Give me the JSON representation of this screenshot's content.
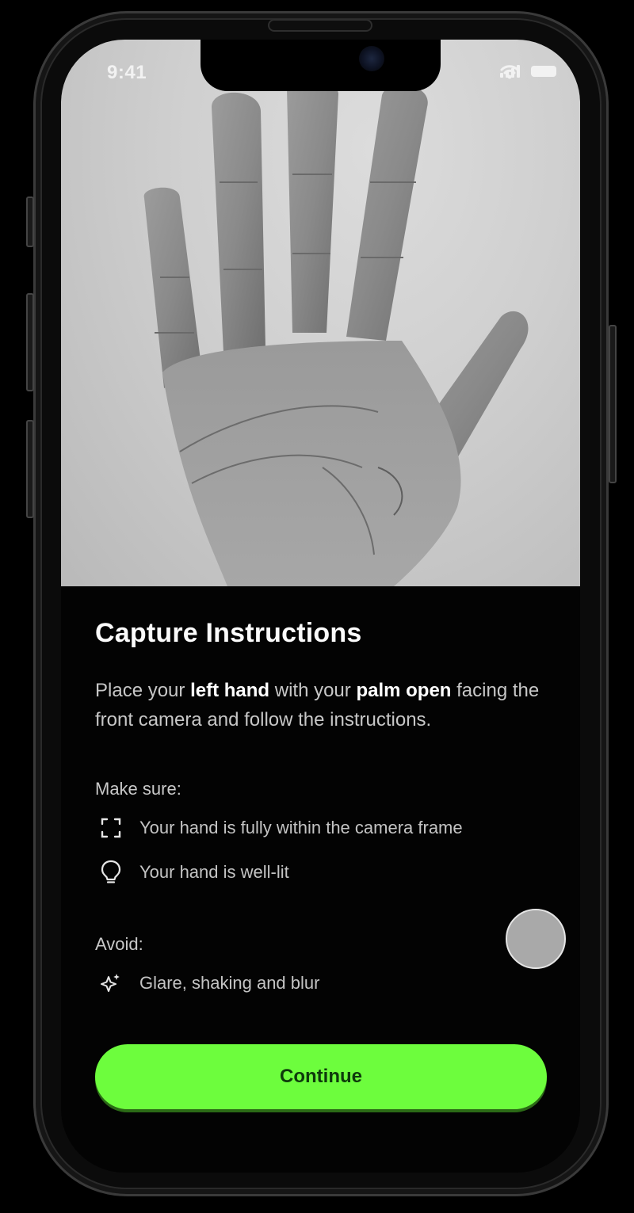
{
  "status_bar": {
    "time": "9:41"
  },
  "photo": {
    "description_icon": "left-hand-palm-image"
  },
  "content": {
    "title": "Capture Instructions",
    "intro_part1": "Place your ",
    "intro_bold1": "left hand",
    "intro_part2": " with your ",
    "intro_bold2": "palm open",
    "intro_part3": " facing the front camera and follow the instructions.",
    "make_sure_label": "Make sure:",
    "make_sure_items": [
      {
        "icon": "frame-corners-icon",
        "text": "Your hand is fully within the camera frame"
      },
      {
        "icon": "lightbulb-icon",
        "text": "Your hand is well-lit"
      }
    ],
    "avoid_label": "Avoid:",
    "avoid_items": [
      {
        "icon": "sparkle-icon",
        "text": "Glare, shaking and blur"
      }
    ]
  },
  "actions": {
    "continue_label": "Continue"
  },
  "colors": {
    "accent": "#6dfd3d",
    "background": "#030303",
    "text_primary": "#ffffff",
    "text_secondary": "#c7c7c7"
  }
}
